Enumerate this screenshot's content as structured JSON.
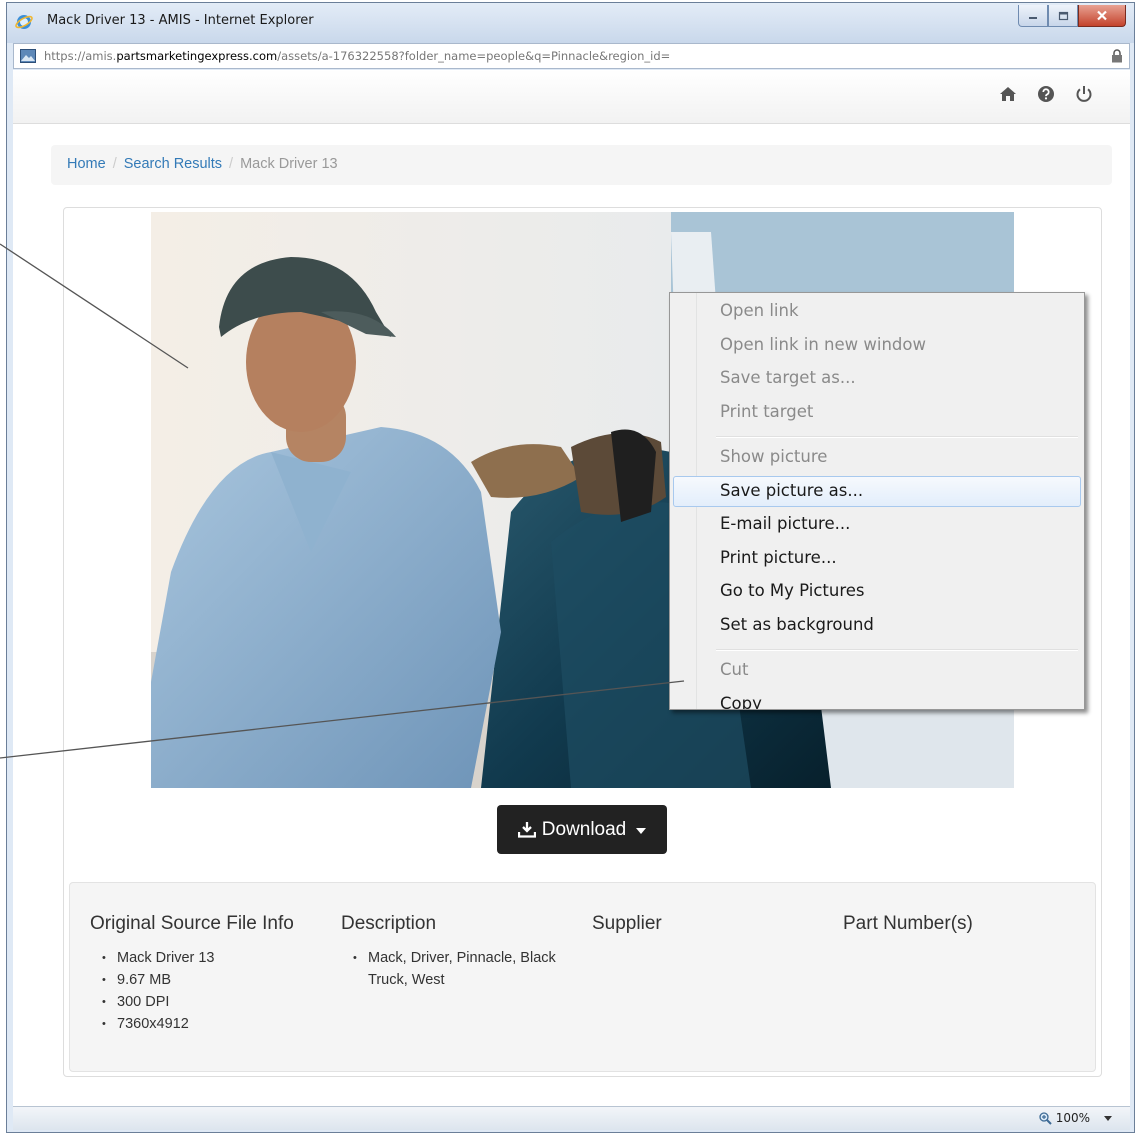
{
  "window": {
    "title": "Mack Driver 13 - AMIS - Internet Explorer",
    "url_prefix": "https://amis.",
    "url_domain": "partsmarketingexpress.com",
    "url_path": "/assets/a-176322558?folder_name=people&q=Pinnacle&region_id="
  },
  "navbar": {
    "icons": [
      "home-icon",
      "help-icon",
      "power-icon"
    ]
  },
  "breadcrumb": {
    "home": "Home",
    "separator": "/",
    "search_results": "Search Results",
    "current": "Mack Driver 13"
  },
  "download_label": "Download",
  "context_menu": {
    "items": [
      "Open link",
      "Open link in new window",
      "Save target as...",
      "Print target",
      "Show picture",
      "Save picture as...",
      "E-mail picture...",
      "Print picture...",
      "Go to My Pictures",
      "Set as background",
      "Cut",
      "Copy"
    ]
  },
  "info": {
    "source_heading": "Original Source File Info",
    "source_items": [
      "Mack Driver 13",
      "9.67 MB",
      "300 DPI",
      "7360x4912"
    ],
    "description_heading": "Description",
    "description_items": [
      "Mack, Driver, Pinnacle, Black Truck, West"
    ],
    "supplier_heading": "Supplier",
    "part_heading": "Part Number(s)"
  },
  "status": {
    "zoom": "100%"
  },
  "colors": {
    "link": "#337ab7",
    "button": "#222222",
    "menu_highlight": "#e3eefb"
  }
}
